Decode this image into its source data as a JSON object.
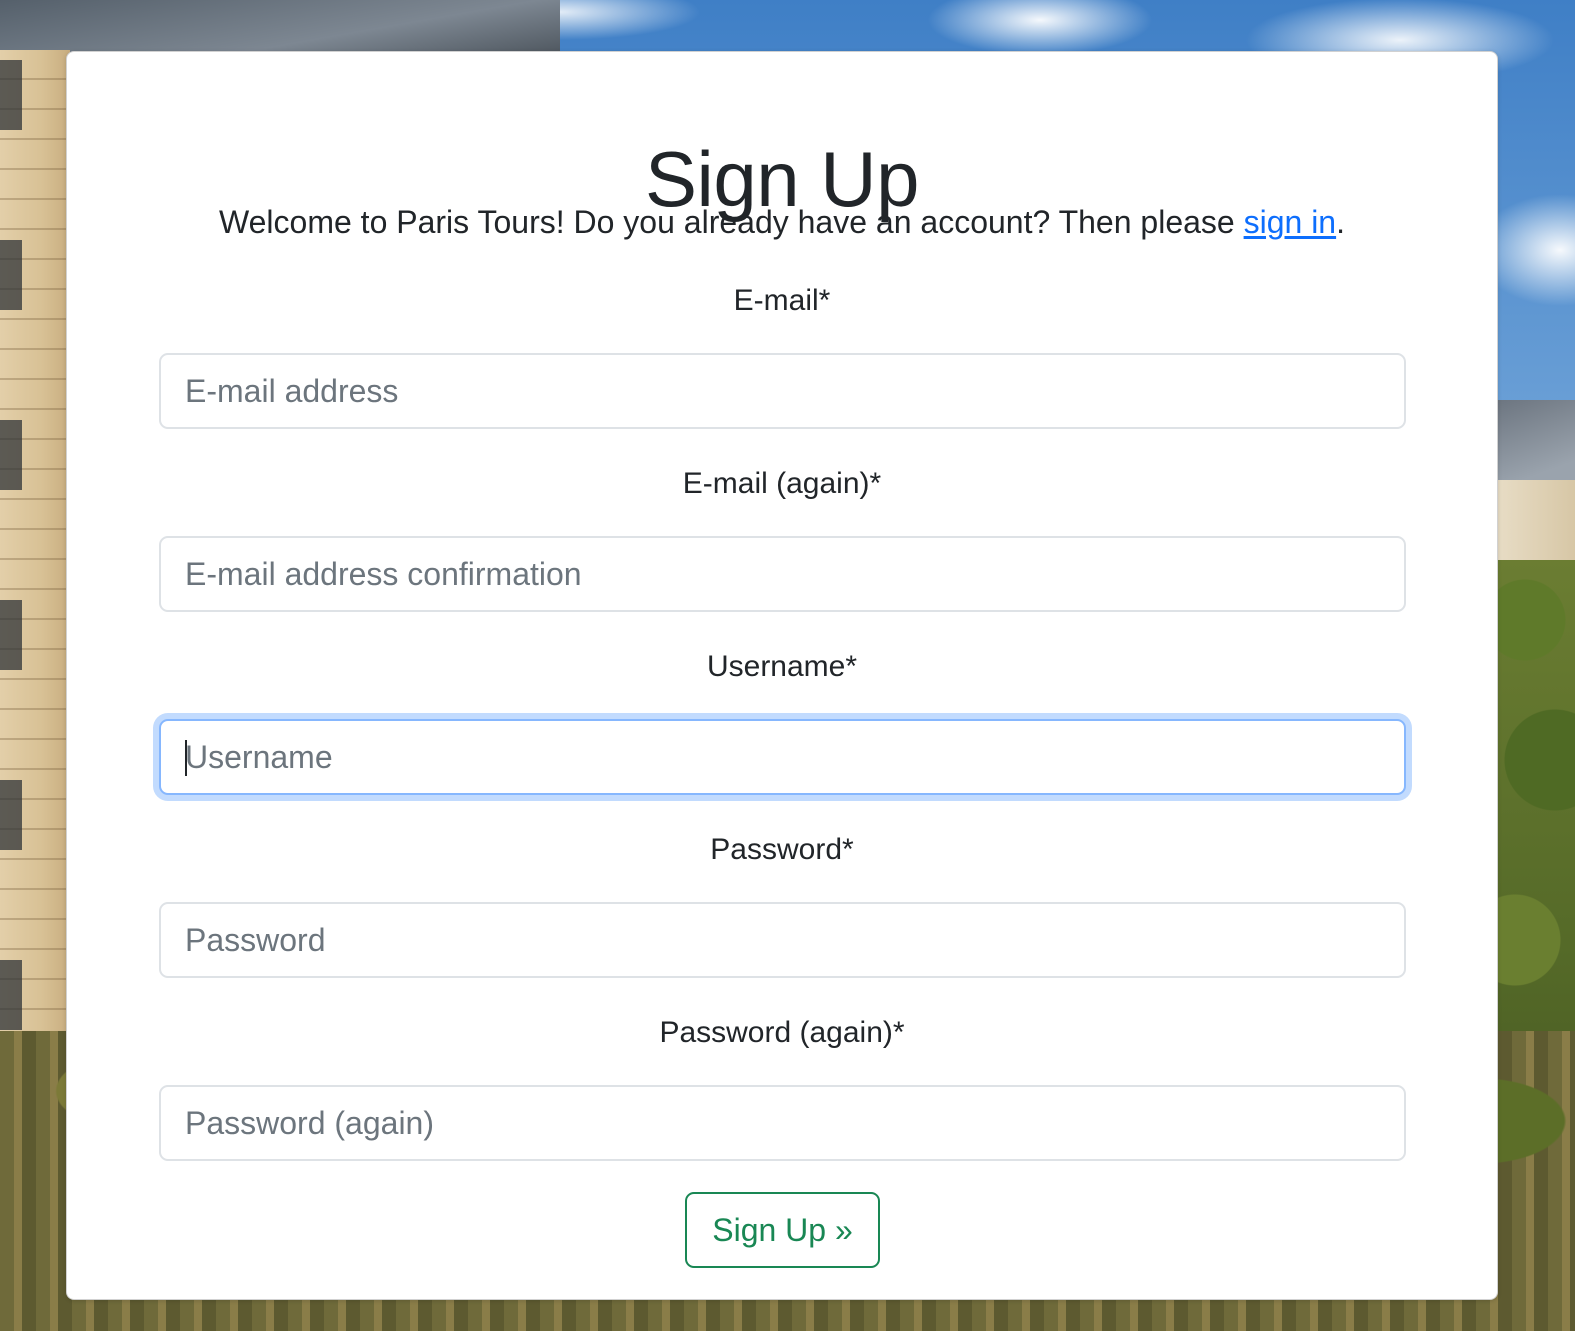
{
  "page": {
    "title": "Sign Up",
    "intro": {
      "text_before": "Welcome to Paris Tours! Do you already have an account? Then please ",
      "link_text": "sign in",
      "text_after": "."
    }
  },
  "form": {
    "fields": [
      {
        "label": "E-mail*",
        "placeholder": "E-mail address",
        "value": "",
        "focused": false
      },
      {
        "label": "E-mail (again)*",
        "placeholder": "E-mail address confirmation",
        "value": "",
        "focused": false
      },
      {
        "label": "Username*",
        "placeholder": "Username",
        "value": "",
        "focused": true
      },
      {
        "label": "Password*",
        "placeholder": "Password",
        "value": "",
        "focused": false
      },
      {
        "label": "Password (again)*",
        "placeholder": "Password (again)",
        "value": "",
        "focused": false
      }
    ],
    "submit_label": "Sign Up »"
  },
  "colors": {
    "link": "#0d6efd",
    "submit": "#198754",
    "focus_ring": "#86b7fe",
    "text": "#212529",
    "placeholder": "#6c757d"
  }
}
